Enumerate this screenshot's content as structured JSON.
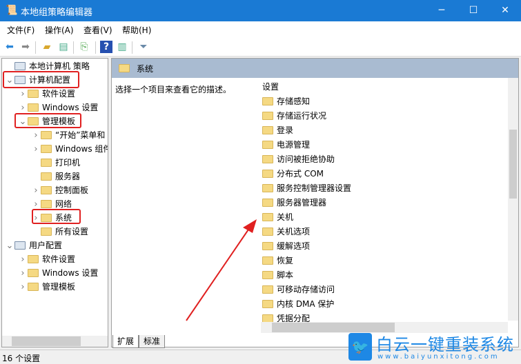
{
  "window": {
    "title": "本地组策略编辑器",
    "min": "─",
    "max": "☐",
    "close": "✕"
  },
  "menu": [
    "文件(F)",
    "操作(A)",
    "查看(V)",
    "帮助(H)"
  ],
  "tree": [
    {
      "label": "本地计算机 策略",
      "level": 0,
      "chev": ""
    },
    {
      "label": "计算机配置",
      "level": 0,
      "chev": "v"
    },
    {
      "label": "软件设置",
      "level": 1,
      "chev": ">"
    },
    {
      "label": "Windows 设置",
      "level": 1,
      "chev": ">"
    },
    {
      "label": "管理模板",
      "level": 1,
      "chev": "v"
    },
    {
      "label": "“开始”菜单和",
      "level": 2,
      "chev": ">"
    },
    {
      "label": "Windows 组件",
      "level": 2,
      "chev": ">"
    },
    {
      "label": "打印机",
      "level": 2,
      "chev": ""
    },
    {
      "label": "服务器",
      "level": 2,
      "chev": ""
    },
    {
      "label": "控制面板",
      "level": 2,
      "chev": ">"
    },
    {
      "label": "网络",
      "level": 2,
      "chev": ">"
    },
    {
      "label": "系统",
      "level": 2,
      "chev": ">"
    },
    {
      "label": "所有设置",
      "level": 2,
      "chev": ""
    },
    {
      "label": "用户配置",
      "level": 0,
      "chev": "v"
    },
    {
      "label": "软件设置",
      "level": 1,
      "chev": ">"
    },
    {
      "label": "Windows 设置",
      "level": 1,
      "chev": ">"
    },
    {
      "label": "管理模板",
      "level": 1,
      "chev": ">"
    }
  ],
  "right": {
    "header": "系统",
    "description": "选择一个项目来查看它的描述。",
    "column": "设置",
    "items": [
      "存储感知",
      "存储运行状况",
      "登录",
      "电源管理",
      "访问被拒绝协助",
      "分布式 COM",
      "服务控制管理器设置",
      "服务器管理器",
      "关机",
      "关机选项",
      "缓解选项",
      "恢复",
      "脚本",
      "可移动存储访问",
      "内核 DMA 保护",
      "凭据分配"
    ]
  },
  "tabs": [
    "扩展",
    "标准"
  ],
  "status": "16 个设置",
  "watermark": {
    "name": "白云一键重装系统",
    "url": "www.baiyunxitong.com"
  },
  "colors": {
    "titlebar": "#1a7ad4",
    "highlight": "#e02020",
    "header": "#a9bbd1"
  }
}
